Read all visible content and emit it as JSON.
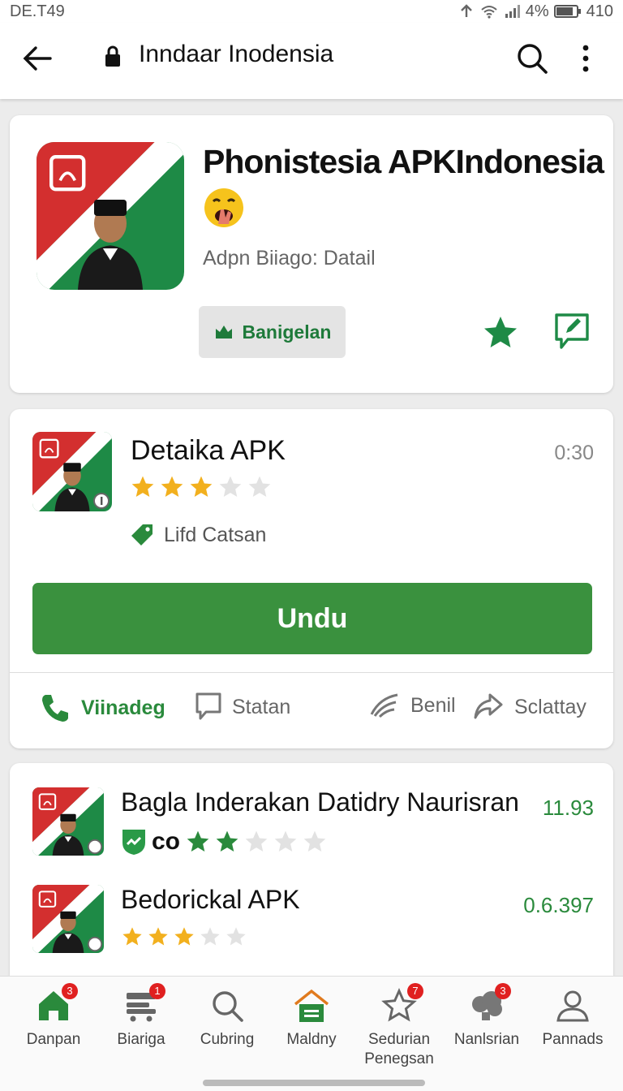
{
  "status_bar": {
    "time": "DE.T49",
    "battery": "4%",
    "right_number": "410"
  },
  "app_bar": {
    "title": "Inndaar Inodensia"
  },
  "hero": {
    "app_name": "Phonistesia APKIndonesia",
    "subtitle": "Adpn Biiago: Datail",
    "badge_label": "Banigelan"
  },
  "detail": {
    "name": "Detaika APK",
    "time": "0:30",
    "rating": 3,
    "tag": "Lifd Catsan",
    "download_label": "Undu",
    "actions": [
      "Viinadeg",
      "Statan",
      "Benil",
      "Sclattay"
    ]
  },
  "related": [
    {
      "name": "Bagla Inderakan Datidry Naurisran",
      "version": "11.93",
      "badge_text": "co",
      "rating": 2
    },
    {
      "name": "Bedorickal APK",
      "version": "0.6.397",
      "rating": 3
    }
  ],
  "bottom_nav": [
    {
      "label": "Danpan",
      "badge": "3"
    },
    {
      "label": "Biariga",
      "badge": "1"
    },
    {
      "label": "Cubring",
      "badge": ""
    },
    {
      "label": "Maldny",
      "badge": ""
    },
    {
      "label": "Sedurian Penegsan",
      "badge": "7"
    },
    {
      "label": "Nanlsrian",
      "badge": "3"
    },
    {
      "label": "Pannads",
      "badge": ""
    }
  ],
  "colors": {
    "green": "#2a8a3c",
    "download_green": "#3a913e",
    "red": "#c62828",
    "star": "#f2b01e"
  }
}
